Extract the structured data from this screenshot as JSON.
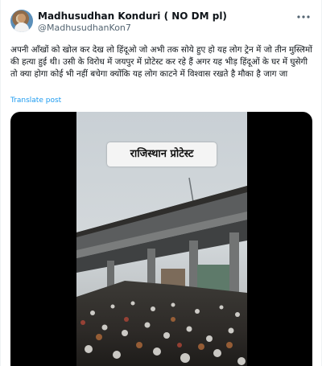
{
  "author": {
    "name": "Madhusudhan Konduri ( NO DM pl)",
    "handle": "@MadhusudhanKon7"
  },
  "post": {
    "text": "अपनी आँखों को खोल कर देख लो हिंदूओ जो अभी तक सोये हुए हो यह लोग ट्रेन में जो तीन मुस्लिमों की हत्या हुई थी। उसी के विरोध में जयपुर में प्रोटेस्ट कर रहे हैं अगर यह भीड़ हिंदूओं के घर में घुसेगी तो क्या होगा कोई भी नहीं बचेगा क्योंकि यह लोग काटने में विश्वास रखते है मौका है जाग जा",
    "translate_label": "Translate post"
  },
  "media": {
    "video_caption": "राजिस्थान प्रोटेस्ट"
  },
  "icons": {
    "more": "more-options-icon",
    "avatar": "user-avatar"
  }
}
